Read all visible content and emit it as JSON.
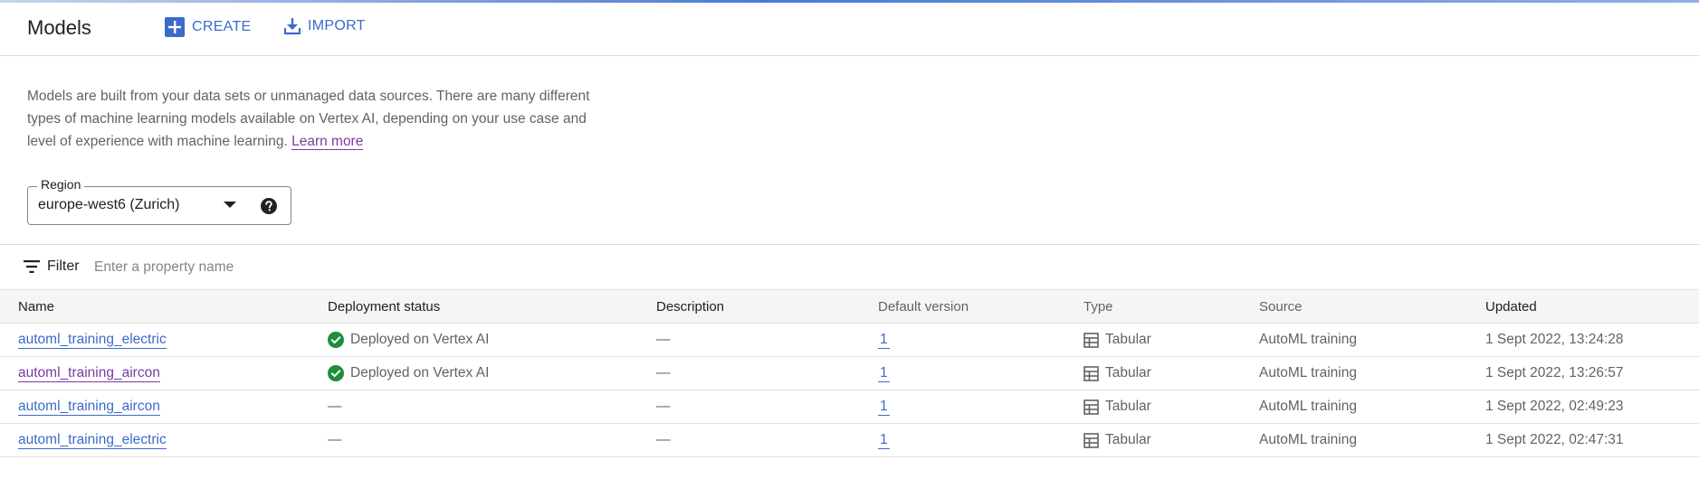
{
  "header": {
    "title": "Models",
    "create_label": "CREATE",
    "import_label": "IMPORT"
  },
  "intro": {
    "text": "Models are built from your data sets or unmanaged data sources. There are many different types of machine learning models available on Vertex AI, depending on your use case and level of experience with machine learning. ",
    "learn_more": "Learn more"
  },
  "region": {
    "label": "Region",
    "value": "europe-west6 (Zurich)"
  },
  "filter": {
    "label": "Filter",
    "placeholder": "Enter a property name"
  },
  "table": {
    "columns": {
      "name": "Name",
      "status": "Deployment status",
      "description": "Description",
      "version": "Default version",
      "type": "Type",
      "source": "Source",
      "updated": "Updated"
    },
    "rows": [
      {
        "name": "automl_training_electric",
        "status": "Deployed on Vertex AI",
        "description": "—",
        "version": "1",
        "type": "Tabular",
        "source": "AutoML training",
        "updated": "1 Sept 2022, 13:24:28"
      },
      {
        "name": "automl_training_aircon",
        "status": "Deployed on Vertex AI",
        "description": "—",
        "version": "1",
        "type": "Tabular",
        "source": "AutoML training",
        "updated": "1 Sept 2022, 13:26:57"
      },
      {
        "name": "automl_training_aircon",
        "status": "—",
        "description": "—",
        "version": "1",
        "type": "Tabular",
        "source": "AutoML training",
        "updated": "1 Sept 2022, 02:49:23"
      },
      {
        "name": "automl_training_electric",
        "status": "—",
        "description": "—",
        "version": "1",
        "type": "Tabular",
        "source": "AutoML training",
        "updated": "1 Sept 2022, 02:47:31"
      }
    ]
  },
  "colors": {
    "accent": "#3c6bc9",
    "visited_link": "#7b3aa0",
    "success": "#1e8e3e"
  },
  "icons": {
    "create": "add-box-icon",
    "import": "download-icon",
    "region_dropdown": "triangle-down-icon",
    "region_help": "help-circle-icon",
    "filter": "filter-lines-icon",
    "deployed": "check-circle-icon",
    "type": "table-grid-icon"
  }
}
